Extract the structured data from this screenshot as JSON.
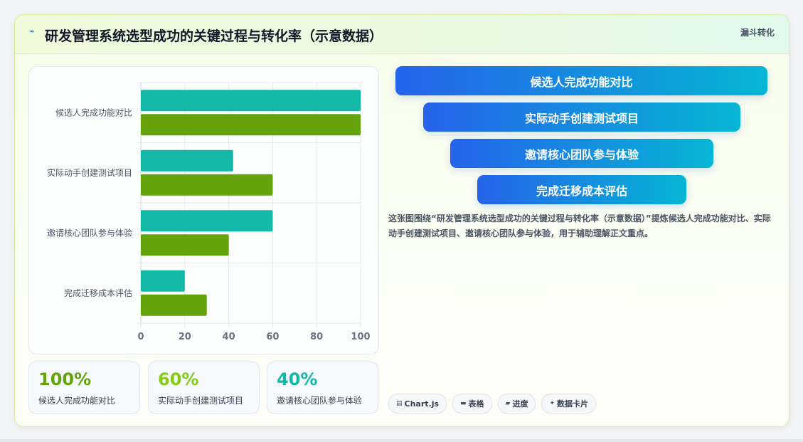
{
  "header": {
    "icon": "trend-icon",
    "title": "研发管理系统选型成功的关键过程与转化率（示意数据）",
    "tag": "漏斗转化"
  },
  "chart_data": {
    "type": "bar",
    "orientation": "horizontal",
    "categories": [
      "候选人完成功能对比",
      "实际动手创建测试项目",
      "邀请核心团队参与体验",
      "完成迁移成本评估"
    ],
    "series": [
      {
        "values": [
          100,
          42,
          60,
          20
        ],
        "color": "#14b8a6"
      },
      {
        "values": [
          100,
          60,
          40,
          30
        ],
        "color": "#65a30d"
      }
    ],
    "xlim": [
      0,
      100
    ],
    "xticks": [
      0,
      20,
      40,
      60,
      80,
      100
    ],
    "grid": true
  },
  "stats": [
    {
      "value": "100%",
      "label": "候选人完成功能对比",
      "color": "#65a30d"
    },
    {
      "value": "60%",
      "label": "实际动手创建测试项目",
      "color": "#84cc16"
    },
    {
      "value": "40%",
      "label": "邀请核心团队参与体验",
      "color": "#14b8a6"
    }
  ],
  "funnel": [
    "候选人完成功能对比",
    "实际动手创建测试项目",
    "邀请核心团队参与体验",
    "完成迁移成本评估"
  ],
  "description": "这张图围绕“研发管理系统选型成功的关键过程与转化率（示意数据）”提炼候选人完成功能对比、实际动手创建测试项目、邀请核心团队参与体验，用于辅助理解正文重点。",
  "chips": [
    {
      "icon": "chart-icon",
      "glyph": "▤",
      "label": "Chart.js"
    },
    {
      "icon": "table-icon",
      "glyph": "▬",
      "label": "表格"
    },
    {
      "icon": "progress-icon",
      "glyph": "▰",
      "label": "进度"
    },
    {
      "icon": "sparkle-icon",
      "glyph": "✦",
      "label": "数据卡片"
    }
  ]
}
